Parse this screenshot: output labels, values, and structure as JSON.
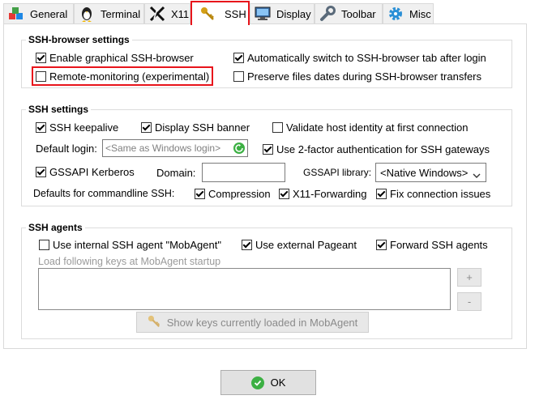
{
  "tabs": [
    {
      "label": "General",
      "icon": "blocks-icon"
    },
    {
      "label": "Terminal",
      "icon": "tux-icon"
    },
    {
      "label": "X11",
      "icon": "x11-icon"
    },
    {
      "label": "SSH",
      "icon": "key-icon"
    },
    {
      "label": "Display",
      "icon": "monitor-icon"
    },
    {
      "label": "Toolbar",
      "icon": "wrench-icon"
    },
    {
      "label": "Misc",
      "icon": "gear-icon"
    }
  ],
  "browser": {
    "title": "SSH-browser settings",
    "enable_graphical": "Enable graphical SSH-browser",
    "auto_switch": "Automatically switch to SSH-browser tab after login",
    "remote_monitoring": "Remote-monitoring (experimental)",
    "preserve_dates": "Preserve files dates during SSH-browser transfers"
  },
  "ssh": {
    "title": "SSH settings",
    "keepalive": "SSH keepalive",
    "display_banner": "Display SSH banner",
    "validate_host": "Validate host identity at first connection",
    "default_login_label": "Default login:",
    "default_login_placeholder": "<Same as Windows login>",
    "two_factor": "Use 2-factor authentication for SSH gateways",
    "gssapi": "GSSAPI Kerberos",
    "domain_label": "Domain:",
    "gssapi_library_label": "GSSAPI library:",
    "gssapi_library_value": "<Native Windows>",
    "defaults_label": "Defaults for commandline SSH:",
    "compression": "Compression",
    "x11_forwarding": "X11-Forwarding",
    "fix_issues": "Fix connection issues"
  },
  "agents": {
    "title": "SSH agents",
    "use_internal": "Use internal SSH agent \"MobAgent\"",
    "use_external": "Use external Pageant",
    "forward": "Forward SSH agents",
    "load_keys_label": "Load following keys at MobAgent startup",
    "plus": "+",
    "minus": "-",
    "show_keys": "Show keys currently loaded in MobAgent"
  },
  "ok_label": "OK",
  "colors": {
    "highlight": "#e8141b",
    "ok_icon": "#3cb043"
  }
}
